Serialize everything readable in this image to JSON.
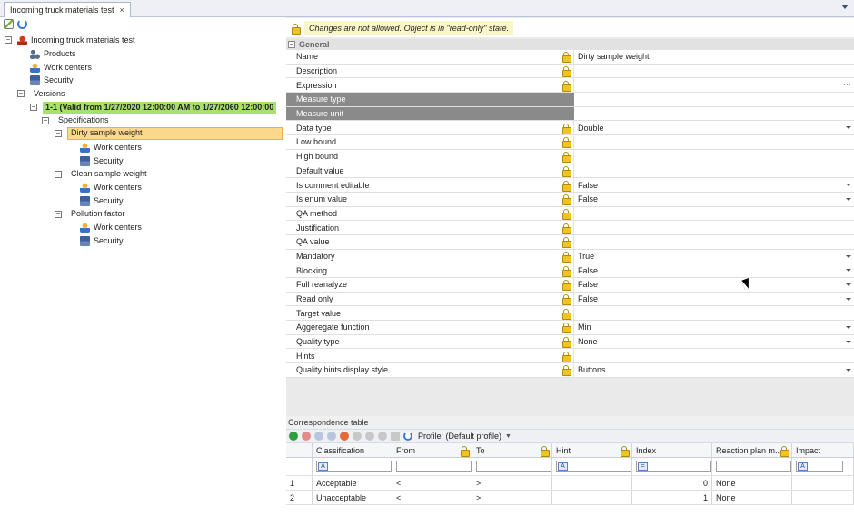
{
  "tab": {
    "title": "Incoming truck materials test",
    "close": "×"
  },
  "tree": {
    "root": "Incoming truck materials test",
    "products": "Products",
    "work_centers": "Work centers",
    "security": "Security",
    "versions": "Versions",
    "version_item": "1-1 (Valid from 1/27/2020 12:00:00 AM to 1/27/2060 12:00:00",
    "specifications": "Specifications",
    "specs": [
      {
        "name": "Dirty sample weight",
        "work_centers": "Work centers",
        "security": "Security"
      },
      {
        "name": "Clean sample weight",
        "work_centers": "Work centers",
        "security": "Security"
      },
      {
        "name": "Pollution factor",
        "work_centers": "Work centers",
        "security": "Security"
      }
    ]
  },
  "banner": {
    "message": "Changes are not allowed. Object is in \"read-only\" state."
  },
  "properties": {
    "group": "General",
    "rows": [
      {
        "name": "Name",
        "value": "Dirty sample weight"
      },
      {
        "name": "Description",
        "value": ""
      },
      {
        "name": "Expression",
        "value": ""
      },
      {
        "name": "Measure type",
        "value": ""
      },
      {
        "name": "Measure unit",
        "value": ""
      },
      {
        "name": "Data type",
        "value": "Double"
      },
      {
        "name": "Low bound",
        "value": ""
      },
      {
        "name": "High bound",
        "value": ""
      },
      {
        "name": "Default value",
        "value": ""
      },
      {
        "name": "Is comment editable",
        "value": "False"
      },
      {
        "name": "Is enum value",
        "value": "False"
      },
      {
        "name": "QA method",
        "value": ""
      },
      {
        "name": "Justification",
        "value": ""
      },
      {
        "name": "QA value",
        "value": ""
      },
      {
        "name": "Mandatory",
        "value": "True"
      },
      {
        "name": "Blocking",
        "value": "False"
      },
      {
        "name": "Full reanalyze",
        "value": "False"
      },
      {
        "name": "Read only",
        "value": "False"
      },
      {
        "name": "Target value",
        "value": ""
      },
      {
        "name": "Aggeregate function",
        "value": "Min"
      },
      {
        "name": "Quality type",
        "value": "None"
      },
      {
        "name": "Hints",
        "value": ""
      },
      {
        "name": "Quality hints display style",
        "value": "Buttons"
      }
    ]
  },
  "correspondence": {
    "title": "Correspondence table",
    "profile": "Profile: (Default profile)",
    "columns": [
      "Classification",
      "From",
      "To",
      "Hint",
      "Index",
      "Reaction plan m...",
      "Impact"
    ],
    "rows": [
      {
        "num": "1",
        "classification": "Acceptable",
        "from": "<",
        "to": ">",
        "hint": "",
        "index": "0",
        "reaction": "None",
        "impact": ""
      },
      {
        "num": "2",
        "classification": "Unacceptable",
        "from": "<",
        "to": ">",
        "hint": "",
        "index": "1",
        "reaction": "None",
        "impact": ""
      }
    ]
  }
}
